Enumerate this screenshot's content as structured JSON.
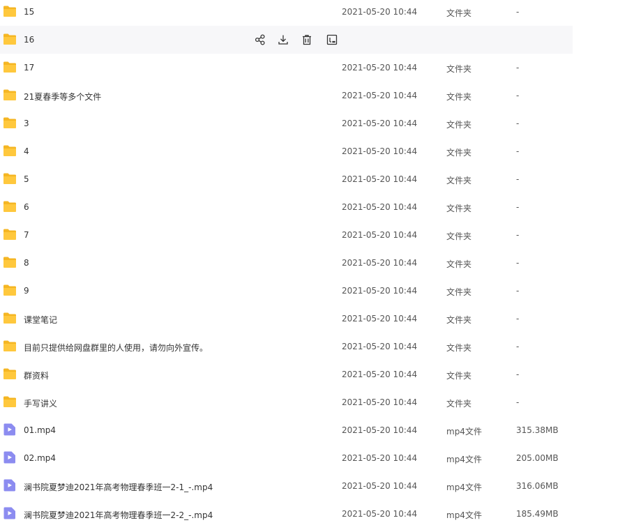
{
  "rows": [
    {
      "kind": "folder",
      "name": "15",
      "time": "2021-05-20 10:44",
      "type": "文件夹",
      "size": "-"
    },
    {
      "kind": "folder",
      "name": "16",
      "hover": true,
      "actions": [
        "share-icon",
        "download-icon",
        "delete-icon",
        "rename-icon"
      ]
    },
    {
      "kind": "folder",
      "name": "17",
      "time": "2021-05-20 10:44",
      "type": "文件夹",
      "size": "-"
    },
    {
      "kind": "folder",
      "name": "21夏春季等多个文件",
      "time": "2021-05-20 10:44",
      "type": "文件夹",
      "size": "-"
    },
    {
      "kind": "folder",
      "name": "3",
      "time": "2021-05-20 10:44",
      "type": "文件夹",
      "size": "-"
    },
    {
      "kind": "folder",
      "name": "4",
      "time": "2021-05-20 10:44",
      "type": "文件夹",
      "size": "-"
    },
    {
      "kind": "folder",
      "name": "5",
      "time": "2021-05-20 10:44",
      "type": "文件夹",
      "size": "-"
    },
    {
      "kind": "folder",
      "name": "6",
      "time": "2021-05-20 10:44",
      "type": "文件夹",
      "size": "-"
    },
    {
      "kind": "folder",
      "name": "7",
      "time": "2021-05-20 10:44",
      "type": "文件夹",
      "size": "-"
    },
    {
      "kind": "folder",
      "name": "8",
      "time": "2021-05-20 10:44",
      "type": "文件夹",
      "size": "-"
    },
    {
      "kind": "folder",
      "name": "9",
      "time": "2021-05-20 10:44",
      "type": "文件夹",
      "size": "-"
    },
    {
      "kind": "folder",
      "name": "课堂笔记",
      "time": "2021-05-20 10:44",
      "type": "文件夹",
      "size": "-"
    },
    {
      "kind": "folder",
      "name": "目前只提供给网盘群里的人使用，请勿向外宣传。",
      "time": "2021-05-20 10:44",
      "type": "文件夹",
      "size": "-"
    },
    {
      "kind": "folder",
      "name": "群资料",
      "time": "2021-05-20 10:44",
      "type": "文件夹",
      "size": "-"
    },
    {
      "kind": "folder",
      "name": "手写讲义",
      "time": "2021-05-20 10:44",
      "type": "文件夹",
      "size": "-"
    },
    {
      "kind": "video",
      "name": "01.mp4",
      "time": "2021-05-20 10:44",
      "type": "mp4文件",
      "size": "315.38MB"
    },
    {
      "kind": "video",
      "name": "02.mp4",
      "time": "2021-05-20 10:44",
      "type": "mp4文件",
      "size": "205.00MB"
    },
    {
      "kind": "video",
      "name": "澜书院夏梦迪2021年高考物理春季班一2-1_-.mp4",
      "time": "2021-05-20 10:44",
      "type": "mp4文件",
      "size": "316.06MB"
    },
    {
      "kind": "video",
      "name": "澜书院夏梦迪2021年高考物理春季班一2-2_-.mp4",
      "time": "2021-05-20 10:44",
      "type": "mp4文件",
      "size": "185.49MB"
    }
  ],
  "colors": {
    "folder": "#ffc83d",
    "folder_tab": "#f5b623",
    "video": "#8c8cf0",
    "video_play": "#ffffff",
    "hover_bg": "#f7f7f9",
    "icon_stroke": "#333333"
  }
}
